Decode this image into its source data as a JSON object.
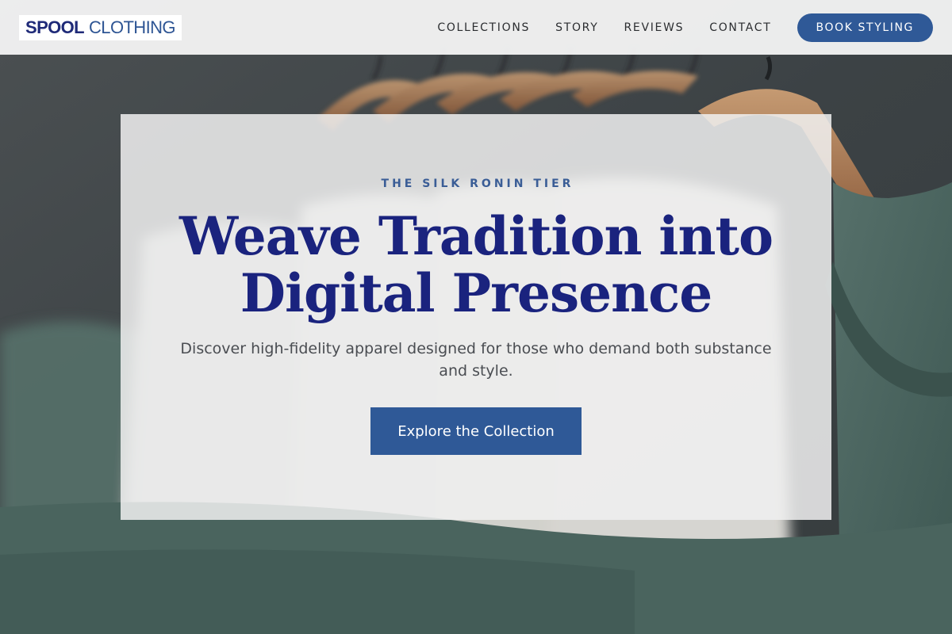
{
  "header": {
    "logo": {
      "strong": "SPOOL",
      "light": "CLOTHING"
    },
    "nav": [
      {
        "label": "COLLECTIONS"
      },
      {
        "label": "STORY"
      },
      {
        "label": "REVIEWS"
      },
      {
        "label": "CONTACT"
      }
    ],
    "cta_label": "BOOK STYLING"
  },
  "hero": {
    "eyebrow": "THE SILK RONIN TIER",
    "headline_line1": "Weave Tradition into",
    "headline_line2": "Digital Presence",
    "subhead": "Discover high-fidelity apparel designed for those who demand both substance and style.",
    "button_label": "Explore the Collection"
  },
  "colors": {
    "brand_navy": "#1a237e",
    "accent_blue": "#2f5997",
    "shirt_green": "#46605a"
  }
}
